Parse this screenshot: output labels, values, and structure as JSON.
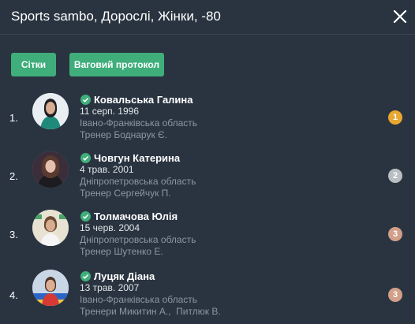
{
  "header": {
    "title": "Sports sambo, Дорослі, Жінки, -80"
  },
  "buttons": {
    "grids": "Сітки",
    "weigh_protocol": "Ваговий протокол"
  },
  "icons": {
    "close": "close-icon",
    "verified": "check-circle-icon"
  },
  "colors": {
    "background": "#2a3440",
    "accent": "#3fae7b",
    "gold": "#e8a730",
    "silver": "#b9bec3",
    "bronze": "#d29f88"
  },
  "athletes": [
    {
      "number": "1.",
      "name": "Ковальська Галина",
      "dob": "11 серп. 1996",
      "region": "Івано-Франківська область",
      "coach": "Тренер Боднарук Є.",
      "place": "1"
    },
    {
      "number": "2.",
      "name": "Човгун Катерина",
      "dob": "4 трав. 2001",
      "region": "Дніпропетровська область",
      "coach": "Тренер Сергейчук П.",
      "place": "2"
    },
    {
      "number": "3.",
      "name": "Толмачова Юлія",
      "dob": "15 черв. 2004",
      "region": "Дніпропетровська область",
      "coach": "Тренер Шутенко Е.",
      "place": "3"
    },
    {
      "number": "4.",
      "name": "Луцяк Діана",
      "dob": "13 трав. 2007",
      "region": "Івано-Франківська область",
      "coach": "Тренери Микитин А.,  Питлюк В.",
      "place": "3"
    }
  ]
}
